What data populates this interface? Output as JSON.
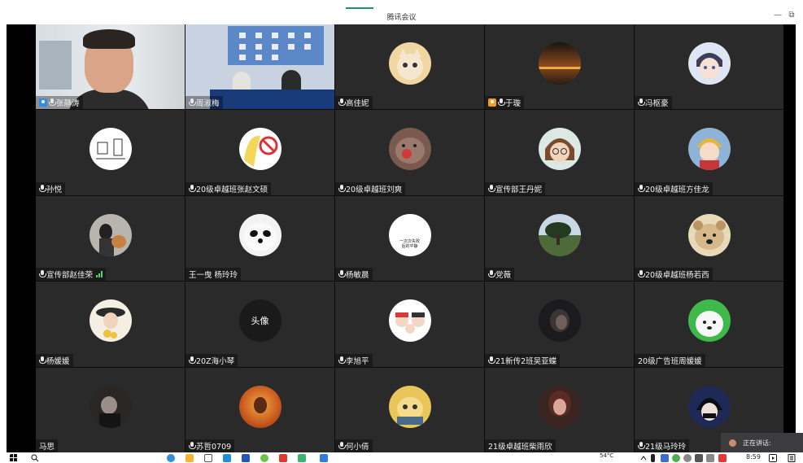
{
  "window": {
    "title": "腾讯会议",
    "minimize_glyph": "—",
    "restore_glyph": "⧉"
  },
  "participants": [
    {
      "name": "张静涛",
      "avatar": "camera-video-man"
    },
    {
      "name": "周淑梅",
      "avatar": "camera-video-classroom"
    },
    {
      "name": "高佳妮",
      "avatar": "cat-avatar"
    },
    {
      "name": "于璇",
      "avatar": "sunset-avatar"
    },
    {
      "name": "冯枢豪",
      "avatar": "anime-boy-avatar"
    },
    {
      "name": "孙悦",
      "avatar": "sketch-avatar"
    },
    {
      "name": "20级卓越班张赵文硕",
      "avatar": "cartoon-girl-avatar"
    },
    {
      "name": "20级卓越班刘爽",
      "avatar": "cat-face-avatar"
    },
    {
      "name": "宣传部王丹妮",
      "avatar": "cartoon-glasses-avatar"
    },
    {
      "name": "20级卓越班方佳龙",
      "avatar": "cartoon-blond-avatar"
    },
    {
      "name": "宣传部赵佳荣",
      "avatar": "photo-avatar"
    },
    {
      "name": "王一曳 杨玲玲",
      "avatar": "panda-avatar"
    },
    {
      "name": "杨敏晨",
      "avatar": "sticker-avatar"
    },
    {
      "name": "党薇",
      "avatar": "tree-avatar"
    },
    {
      "name": "20级卓越班杨若西",
      "avatar": "dog-avatar"
    },
    {
      "name": "杨媛媛",
      "avatar": "flower-hat-avatar"
    },
    {
      "name": "20Z海小琴",
      "avatar": "text-avatar"
    },
    {
      "name": "李旭平",
      "avatar": "family-cartoon-avatar"
    },
    {
      "name": "21新传2班吴亚蝶",
      "avatar": "dark-portrait-avatar"
    },
    {
      "name": "20级广告班周媛媛",
      "avatar": "white-dog-avatar"
    },
    {
      "name": "马思",
      "avatar": "bw-portrait-avatar"
    },
    {
      "name": "苏哲0709",
      "avatar": "orange-art-avatar"
    },
    {
      "name": "何小倩",
      "avatar": "cat-yellow-avatar"
    },
    {
      "name": "21级卓越班柴雨欣",
      "avatar": "girl-portrait-avatar"
    },
    {
      "name": "21级马玲玲",
      "avatar": "anime-dark-avatar"
    }
  ],
  "text_avatar_label": "头像",
  "sticker_text": "一次次失败\n后的平静",
  "speaking_popup": {
    "label": "正在讲话:"
  },
  "taskbar": {
    "weather": "54°C",
    "clock": "8:59"
  },
  "colors": {
    "tile_bg": "#2a2a2b",
    "stage_bg": "#121212",
    "host_badge": "#2d8cf0",
    "guest_badge": "#f39a2b",
    "signal": "#5bd16c"
  }
}
